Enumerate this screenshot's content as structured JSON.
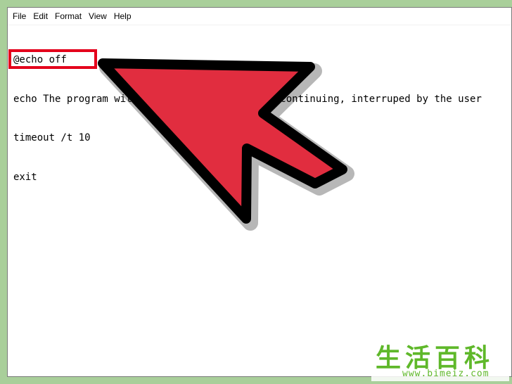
{
  "menu": {
    "items": [
      {
        "label": "File"
      },
      {
        "label": "Edit"
      },
      {
        "label": "Format"
      },
      {
        "label": "View"
      },
      {
        "label": "Help"
      }
    ]
  },
  "editor": {
    "lines": [
      "@echo off",
      "echo The program will wait 10 seconds before continuing, interruped by the user",
      "timeout /t 10",
      "exit"
    ]
  },
  "annotation": {
    "highlight_color": "#e4001b",
    "arrow_color": "#e12d3f",
    "arrow_outline_color": "#000000"
  },
  "watermark": {
    "title": "生活百科",
    "url": "www.bimeiz.com",
    "color": "#5fb82a"
  }
}
